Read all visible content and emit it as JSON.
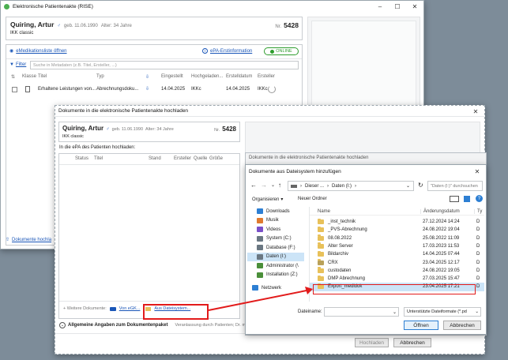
{
  "main_window": {
    "title": "Elektronische Patientenakte (RISE)",
    "patient_name": "Quiring, Artur",
    "birth_prefix": "geb. 11.06.1990",
    "age": "Alter: 34 Jahre",
    "insurer": "IKK classic",
    "nr_label": "Nr.",
    "nr_value": "5428",
    "emedication_link": "eMedikationsliste öffnen",
    "epa_first_info": "ePA-Erstinformation",
    "online_badge": "ONLINE",
    "filter_label": "Filter",
    "search_placeholder": "Suche in Metadaten (z.B. Titel, Ersteller, ...)",
    "columns": [
      "Klasse",
      "Titel",
      "Typ",
      "Eingestellt",
      "Hochgeladen...",
      "Erstelldatum",
      "Ersteller"
    ],
    "row": {
      "title": "Erhaltene Leistungen von...",
      "type": "Abrechnungsdoku...",
      "eingestellt": "14.04.2025",
      "hochgeladen": "IKKc",
      "erstelldatum": "14.04.2025",
      "ersteller": "IKKc"
    },
    "upload_link": "Dokumente hochla"
  },
  "upload_dialog": {
    "title": "Dokumente in die elektronische Patientenakte hochladen",
    "patient_name": "Quiring, Artur",
    "birth_prefix": "geb. 11.06.1990",
    "age": "Alter: 34 Jahre",
    "insurer": "IKK classic",
    "nr_label": "Nr.",
    "nr_value": "5428",
    "section_label": "In die ePA des Patienten hochladen:",
    "columns": [
      "Status",
      "Titel",
      "Stand",
      "Ersteller",
      "Quelle",
      "Größe"
    ],
    "more_docs_label": "+ Weitere Dokumente:",
    "from_egk": "Von eGK...",
    "from_fs": "Aus Dateisystem...",
    "general_info": "Allgemeine Angaben zum Dokumentenpaket",
    "general_info_hint": "Veranlassung durch Patienten; Dr. me",
    "btn_upload": "Hochladen",
    "btn_cancel": "Abbrechen"
  },
  "inner_dialog_title": "Dokumente in die elektronische Patientenakte hochladen",
  "file_dialog": {
    "title": "Dokumente aus Dateisystem hinzufügen",
    "path": [
      "Dieser ...",
      "Daten (I:)"
    ],
    "search_placeholder": "\"Daten (I:)\" durchsuchen",
    "organize": "Organisieren",
    "new_folder": "Neuer Ordner",
    "nav": [
      "Downloads",
      "Musik",
      "Videos",
      "System (C:)",
      "Database (F:)",
      "Daten (I:)",
      "Administrator (\\",
      "Installation (Z:)",
      "Netzwerk"
    ],
    "col_name": "Name",
    "col_date": "Änderungsdatum",
    "col_type": "Ty",
    "files": [
      {
        "name": "_inst_technik",
        "date": "27.12.2024 14:24",
        "t": "D"
      },
      {
        "name": "_PVS-Abrechnung",
        "date": "24.08.2022 19:04",
        "t": "D"
      },
      {
        "name": "08.08.2022",
        "date": "25.08.2022 11:09",
        "t": "D"
      },
      {
        "name": "Alter Server",
        "date": "17.03.2023 11:53",
        "t": "D"
      },
      {
        "name": "Bildarchiv",
        "date": "14.04.2025 07:44",
        "t": "D"
      },
      {
        "name": "CRX",
        "date": "23.04.2025 12:17",
        "t": "D"
      },
      {
        "name": "custodaten",
        "date": "24.08.2022 19:05",
        "t": "D"
      },
      {
        "name": "DMP Abrechnung",
        "date": "27.03.2025 15:47",
        "t": "D"
      },
      {
        "name": "Export_medidok",
        "date": "23.04.2025 17:21",
        "t": "D"
      }
    ],
    "filename_label": "Dateiname:",
    "filename_value": "",
    "filter_value": "Unterstützte Dateiformate (*.pd",
    "btn_open": "Öffnen",
    "btn_cancel": "Abbrechen"
  },
  "colors": {
    "accent": "#1a56b8",
    "highlight": "#e21b1b",
    "selected": "#cce4f7",
    "online": "#2e9d2e"
  }
}
